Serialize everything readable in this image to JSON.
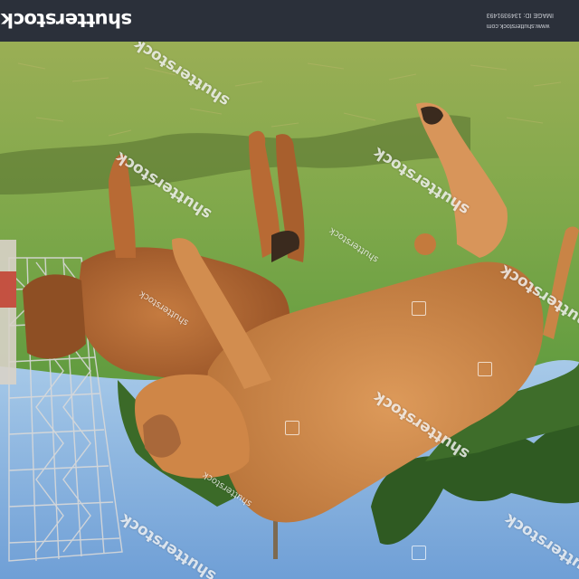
{
  "header": {
    "logo_text": "shutterstock",
    "url_text": "www.shutterstock.com",
    "image_id_text": "IMAGE ID: 1349391493"
  },
  "watermark": {
    "large_text": "shutterstock",
    "small_text": "shutterstock"
  },
  "colors": {
    "header_bg": "#2b303a",
    "grass": "#7da24a",
    "sky": "#8db8e2",
    "cow_tan": "#d58b4a",
    "cow_brown": "#b86a34"
  }
}
